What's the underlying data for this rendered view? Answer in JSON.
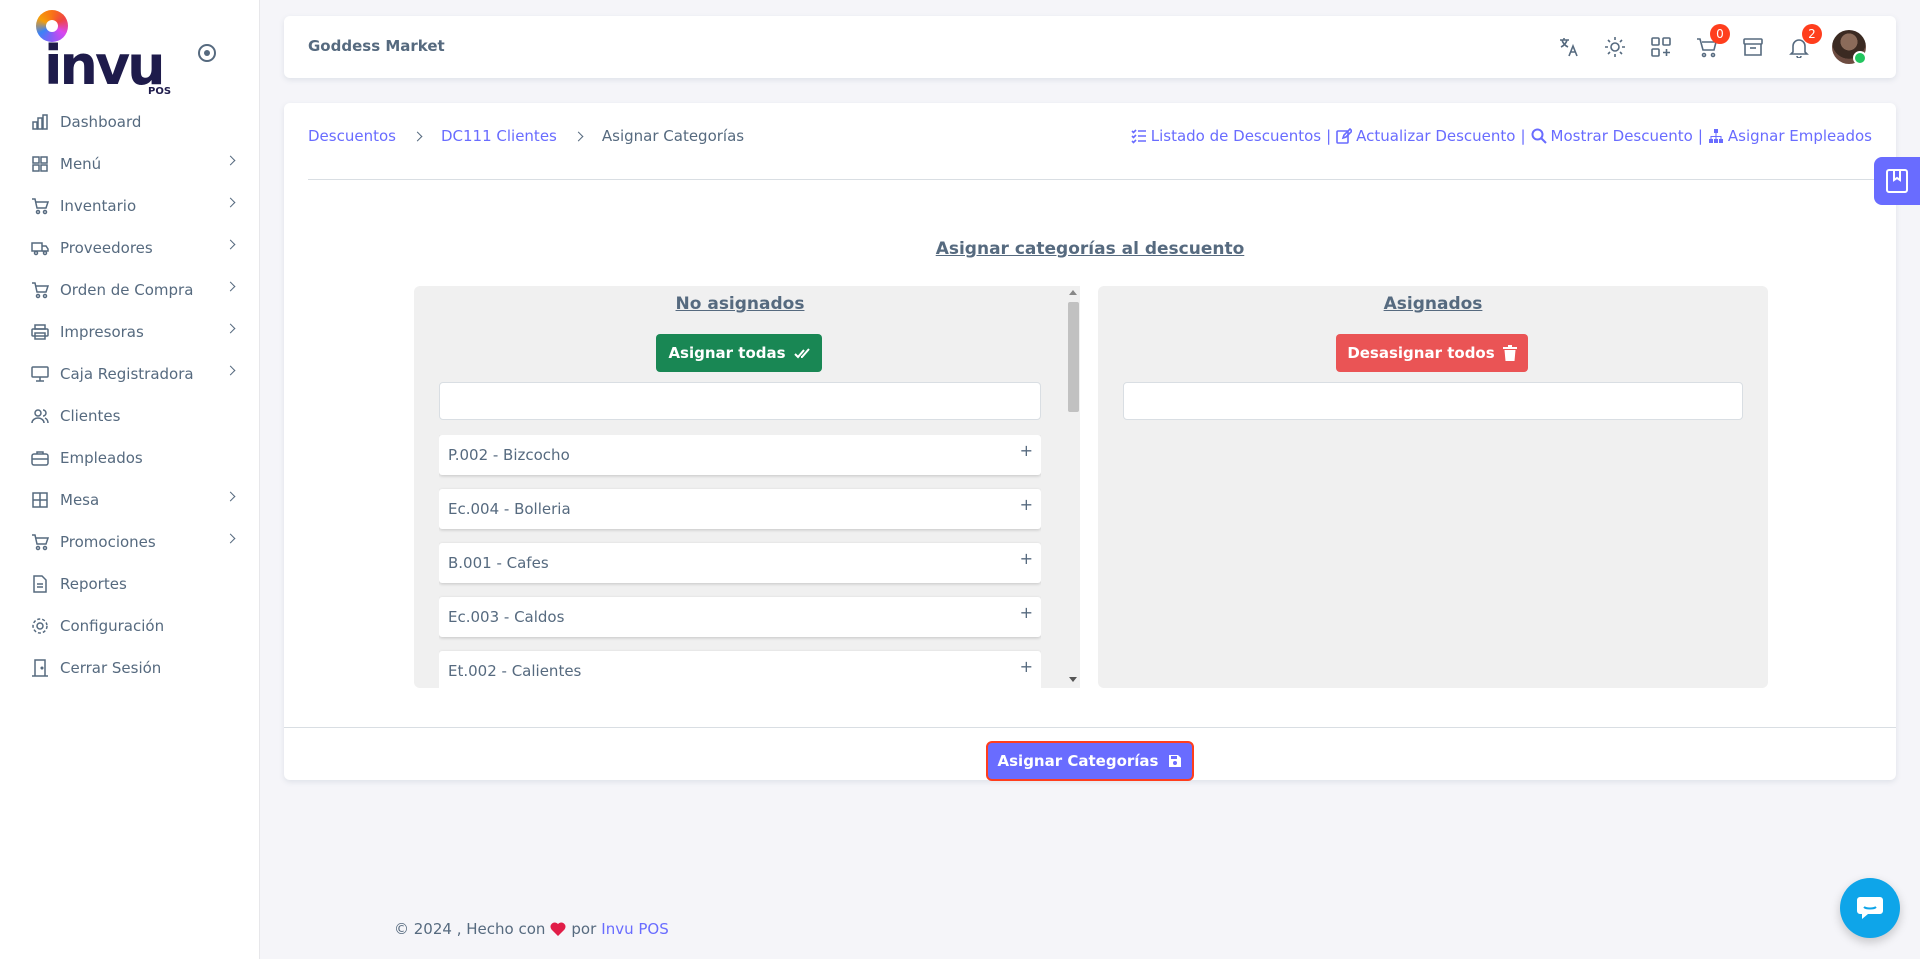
{
  "logo": {
    "text": "invu",
    "sub": "POS"
  },
  "sidebar": {
    "items": [
      {
        "label": "Dashboard",
        "icon": "chart-icon",
        "has_submenu": false
      },
      {
        "label": "Menú",
        "icon": "grid-icon",
        "has_submenu": true
      },
      {
        "label": "Inventario",
        "icon": "cart-icon",
        "has_submenu": true
      },
      {
        "label": "Proveedores",
        "icon": "truck-icon",
        "has_submenu": true
      },
      {
        "label": "Orden de Compra",
        "icon": "cart-icon",
        "has_submenu": true
      },
      {
        "label": "Impresoras",
        "icon": "printer-icon",
        "has_submenu": true
      },
      {
        "label": "Caja Registradora",
        "icon": "register-icon",
        "has_submenu": true
      },
      {
        "label": "Clientes",
        "icon": "users-icon",
        "has_submenu": false
      },
      {
        "label": "Empleados",
        "icon": "briefcase-icon",
        "has_submenu": false
      },
      {
        "label": "Mesa",
        "icon": "table-icon",
        "has_submenu": true
      },
      {
        "label": "Promociones",
        "icon": "cart-icon",
        "has_submenu": true
      },
      {
        "label": "Reportes",
        "icon": "file-icon",
        "has_submenu": false
      },
      {
        "label": "Configuración",
        "icon": "gear-icon",
        "has_submenu": false
      },
      {
        "label": "Cerrar Sesión",
        "icon": "door-icon",
        "has_submenu": false
      }
    ]
  },
  "navbar": {
    "store_name": "Goddess Market",
    "cart_count": "0",
    "notif_count": "2"
  },
  "breadcrumb": {
    "items": [
      "Descuentos",
      "DC111 Clientes"
    ],
    "current": "Asignar Categorías"
  },
  "top_links": {
    "list": "Listado de Descuentos",
    "update": "Actualizar Descuento",
    "show": "Mostrar Descuento",
    "assign_emp": "Asignar Empleados"
  },
  "main": {
    "title": "Asignar categorías al descuento",
    "unassigned": {
      "title": "No asignados",
      "button": "Asignar todas",
      "search_value": "",
      "items": [
        "P.002 - Bizcocho",
        "Ec.004 - Bolleria",
        "B.001 - Cafes",
        "Ec.003 - Caldos",
        "Et.002 - Calientes"
      ]
    },
    "assigned": {
      "title": "Asignados",
      "button": "Desasignar todos",
      "search_value": "",
      "items": []
    },
    "submit": "Asignar Categorías"
  },
  "footer": {
    "text": "© 2024 , Hecho con",
    "by": "por",
    "brand": "Invu POS"
  },
  "colors": {
    "primary": "#696cff",
    "success": "#198754",
    "danger": "#ea5455",
    "badge": "#ff3e1d",
    "chat": "#0ea5e9"
  }
}
